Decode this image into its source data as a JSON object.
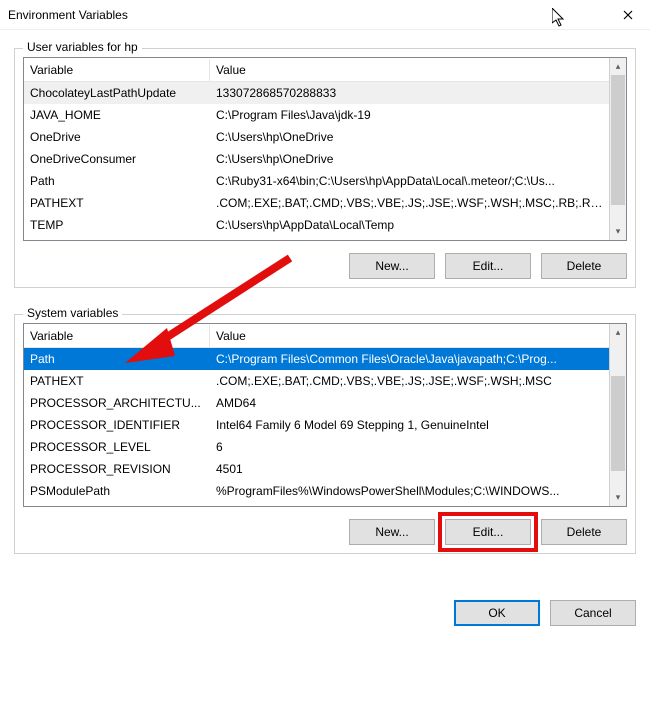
{
  "window": {
    "title": "Environment Variables"
  },
  "user_section": {
    "label": "User variables for hp",
    "headers": {
      "variable": "Variable",
      "value": "Value"
    },
    "rows": [
      {
        "var": "ChocolateyLastPathUpdate",
        "val": "133072868570288833",
        "sel": true
      },
      {
        "var": "JAVA_HOME",
        "val": "C:\\Program Files\\Java\\jdk-19"
      },
      {
        "var": "OneDrive",
        "val": "C:\\Users\\hp\\OneDrive"
      },
      {
        "var": "OneDriveConsumer",
        "val": "C:\\Users\\hp\\OneDrive"
      },
      {
        "var": "Path",
        "val": "C:\\Ruby31-x64\\bin;C:\\Users\\hp\\AppData\\Local\\.meteor/;C:\\Us..."
      },
      {
        "var": "PATHEXT",
        "val": ".COM;.EXE;.BAT;.CMD;.VBS;.VBE;.JS;.JSE;.WSF;.WSH;.MSC;.RB;.RB..."
      },
      {
        "var": "TEMP",
        "val": "C:\\Users\\hp\\AppData\\Local\\Temp"
      }
    ],
    "buttons": {
      "new": "New...",
      "edit": "Edit...",
      "delete": "Delete"
    }
  },
  "system_section": {
    "label": "System variables",
    "headers": {
      "variable": "Variable",
      "value": "Value"
    },
    "rows": [
      {
        "var": "Path",
        "val": "C:\\Program Files\\Common Files\\Oracle\\Java\\javapath;C:\\Prog...",
        "selblue": true
      },
      {
        "var": "PATHEXT",
        "val": ".COM;.EXE;.BAT;.CMD;.VBS;.VBE;.JS;.JSE;.WSF;.WSH;.MSC"
      },
      {
        "var": "PROCESSOR_ARCHITECTU...",
        "val": "AMD64"
      },
      {
        "var": "PROCESSOR_IDENTIFIER",
        "val": "Intel64 Family 6 Model 69 Stepping 1, GenuineIntel"
      },
      {
        "var": "PROCESSOR_LEVEL",
        "val": "6"
      },
      {
        "var": "PROCESSOR_REVISION",
        "val": "4501"
      },
      {
        "var": "PSModulePath",
        "val": "%ProgramFiles%\\WindowsPowerShell\\Modules;C:\\WINDOWS..."
      }
    ],
    "buttons": {
      "new": "New...",
      "edit": "Edit...",
      "delete": "Delete"
    }
  },
  "footer": {
    "ok": "OK",
    "cancel": "Cancel"
  }
}
